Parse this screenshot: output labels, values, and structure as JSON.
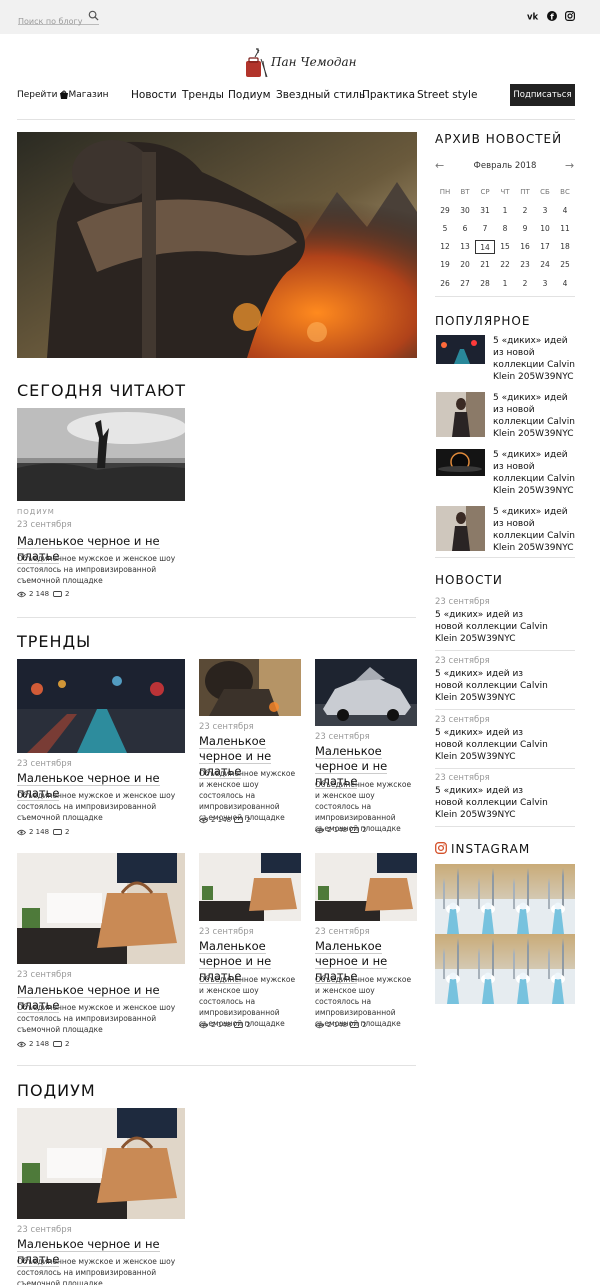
{
  "search": {
    "placeholder": "Поиск по блогу"
  },
  "social": [
    "vk-icon",
    "facebook-icon",
    "instagram-icon"
  ],
  "header": {
    "logo_text": "Пан Чемодан",
    "goto_shop": "Перейти в  Магазин",
    "nav": [
      "Новости",
      "Тренды",
      "Подиум",
      "Звездный стиль",
      "Практика",
      "Street style"
    ],
    "subscribe_label": "Подписаться"
  },
  "today": {
    "title": "СЕГОДНЯ ЧИТАЮТ",
    "card": {
      "tag": "ПОДИУМ",
      "date": "23 сентября",
      "title": "Маленькое черное и не платье",
      "excerpt": "Объединенное мужское и женское шоу состоялось на импровизированной съемочной площадке",
      "views": "2 148",
      "comments": "2"
    }
  },
  "trends": {
    "title": "ТРЕНДЫ",
    "cards": [
      {
        "date": "23 сентября",
        "title": "Маленькое черное и не платье",
        "excerpt": "Объединенное мужское и женское шоу состоялось на импровизированной съемочной площадке",
        "views": "2 148",
        "comments": "2"
      },
      {
        "date": "23 сентября",
        "title": "Маленькое черное и не платье",
        "excerpt": "Объединенное мужское и женское шоу состоялось на импровизированной съемочной площадке",
        "views": "2 148",
        "comments": "2"
      },
      {
        "date": "23 сентября",
        "title": "Маленькое черное и не платье",
        "excerpt": "Объединенное мужское и женское шоу состоялось на импровизированной съемочной площадке",
        "views": "2 148",
        "comments": "2"
      },
      {
        "date": "23 сентября",
        "title": "Маленькое черное и не платье",
        "excerpt": "Объединенное мужское и женское шоу состоялось на импровизированной съемочной площадке",
        "views": "2 148",
        "comments": "2"
      },
      {
        "date": "23 сентября",
        "title": "Маленькое черное и не платье",
        "excerpt": "Объединенное мужское и женское шоу состоялось на импровизированной съемочной площадке",
        "views": "2 148",
        "comments": "2"
      },
      {
        "date": "23 сентября",
        "title": "Маленькое черное и не платье",
        "excerpt": "Объединенное мужское и женское шоу состоялось на импровизированной съемочной площадке",
        "views": "2 148",
        "comments": "2"
      }
    ]
  },
  "podium": {
    "title": "ПОДИУМ",
    "card": {
      "date": "23 сентября",
      "title": "Маленькое черное и не платье",
      "excerpt": "Объединенное мужское и женское шоу состоялось на импровизированной съемочной площадке"
    }
  },
  "sidebar": {
    "archive_title": "АРХИВ НОВОСТЕЙ",
    "calendar": {
      "month": "Февраль 2018",
      "weekdays": [
        "ПН",
        "ВТ",
        "СР",
        "ЧТ",
        "ПТ",
        "СБ",
        "ВС"
      ],
      "weeks": [
        [
          "29",
          "30",
          "31",
          "1",
          "2",
          "3",
          "4"
        ],
        [
          "5",
          "6",
          "7",
          "8",
          "9",
          "10",
          "11"
        ],
        [
          "12",
          "13",
          "14",
          "15",
          "16",
          "17",
          "18"
        ],
        [
          "19",
          "20",
          "21",
          "22",
          "23",
          "24",
          "25"
        ],
        [
          "26",
          "27",
          "28",
          "1",
          "2",
          "3",
          "4"
        ]
      ],
      "today": "14"
    },
    "popular_title": "ПОПУЛЯРНОЕ",
    "popular": [
      "5 «диких» идей из новой коллекции Calvin Klein 205W39NYC",
      "5 «диких» идей из новой коллекции Calvin Klein 205W39NYC",
      "5 «диких» идей из новой коллекции Calvin Klein 205W39NYC",
      "5 «диких» идей из новой коллекции Calvin Klein 205W39NYC"
    ],
    "news_title": "НОВОСТИ",
    "news": [
      {
        "date": "23 сентября",
        "title": "5 «диких» идей из новой коллекции Calvin Klein 205W39NYC"
      },
      {
        "date": "23 сентября",
        "title": "5 «диких» идей из новой коллекции Calvin Klein 205W39NYC"
      },
      {
        "date": "23 сентября",
        "title": "5 «диких» идей из новой коллекции Calvin Klein 205W39NYC"
      },
      {
        "date": "23 сентября",
        "title": "5 «диких» идей из новой коллекции Calvin Klein 205W39NYC"
      }
    ],
    "instagram_title": "INSTAGRAM"
  }
}
